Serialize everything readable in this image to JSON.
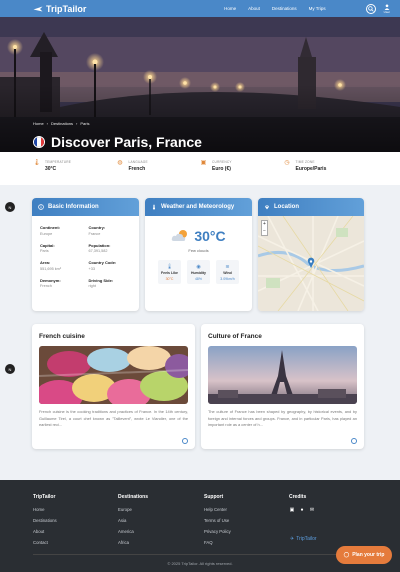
{
  "nav": {
    "brand": "TripTailor",
    "links": [
      "Home",
      "About",
      "Destinations",
      "My Trips"
    ],
    "user_label": "User"
  },
  "hero": {
    "breadcrumb": [
      "Home",
      "Destinations",
      "Paris"
    ],
    "title": "Discover Paris, France"
  },
  "strip": [
    {
      "label": "TEMPERATURE",
      "value": "30°C",
      "icon": "thermometer-icon"
    },
    {
      "label": "LANGUAGE",
      "value": "French",
      "icon": "globe-icon"
    },
    {
      "label": "CURRENCY",
      "value": "Euro (€)",
      "icon": "currency-icon"
    },
    {
      "label": "TIME ZONE",
      "value": "Europe/Paris",
      "icon": "clock-icon"
    }
  ],
  "side_buttons": [
    "N",
    "N"
  ],
  "basic": {
    "title": "Basic Information",
    "fields": [
      {
        "k": "Continent:",
        "v": "Europe"
      },
      {
        "k": "Country:",
        "v": "France"
      },
      {
        "k": "Capital:",
        "v": "Paris"
      },
      {
        "k": "Population:",
        "v": "67,391,582"
      },
      {
        "k": "Area:",
        "v": "551,695 km²"
      },
      {
        "k": "Country Code:",
        "v": "+33"
      },
      {
        "k": "Demonym:",
        "v": "French"
      },
      {
        "k": "Driving Side:",
        "v": "right"
      }
    ]
  },
  "weather": {
    "title": "Weather and Meteorology",
    "temp": "30°C",
    "desc": "Few clouds",
    "stats": [
      {
        "label": "Feels Like",
        "value": "30°C"
      },
      {
        "label": "Humidity",
        "value": "48%"
      },
      {
        "label": "Wind",
        "value": "3.09km/h"
      }
    ]
  },
  "location": {
    "title": "Location"
  },
  "cuisine": {
    "title": "French cuisine",
    "text": "French cuisine is the cooking traditions and practices of France. In the 14th century, Guillaume Tirel, a court chef known as \"Taillevent\", wrote Le Viandier, one of the earliest reci..."
  },
  "culture": {
    "title": "Culture of France",
    "text": "The culture of France has been shaped by geography, by historical events, and by foreign and internal forces and groups. France, and in particular Paris, has played an important role as a center of h..."
  },
  "footer": {
    "cols": [
      {
        "title": "TripTailor",
        "links": [
          "Home",
          "Destinations",
          "About",
          "Contact"
        ]
      },
      {
        "title": "Destinations",
        "links": [
          "Europe",
          "Asia",
          "America",
          "Africa"
        ]
      },
      {
        "title": "Support",
        "links": [
          "Help Center",
          "Terms of Use",
          "Privacy Policy",
          "FAQ"
        ]
      },
      {
        "title": "Credits",
        "links": []
      }
    ],
    "brand": "TripTailor",
    "copyright": "© 2025 TripTailor. All rights reserved."
  },
  "plan_button": "Plan your trip",
  "colors": {
    "primary": "#4a88c8",
    "accent": "#e57b3c",
    "footer": "#2a2e33"
  }
}
